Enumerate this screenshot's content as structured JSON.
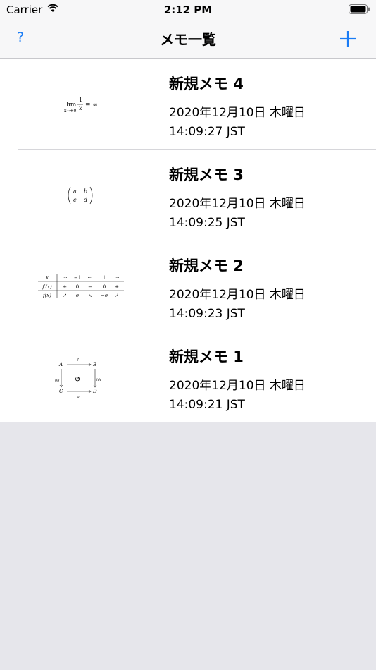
{
  "status_bar": {
    "carrier": "Carrier",
    "time": "2:12 PM",
    "icons": [
      "wifi-icon",
      "battery-icon"
    ]
  },
  "nav": {
    "help_label": "?",
    "title": "メモ一覧",
    "add_icon": "plus-icon",
    "accent_color": "#1a7cf5"
  },
  "memos": [
    {
      "title": "新規メモ 4",
      "date": "2020年12月10日 木曜日",
      "time": "14:09:27 JST",
      "thumbnail": {
        "kind": "limit",
        "lim": "lim",
        "sub": "x→+0",
        "num": "1",
        "den": "x",
        "rhs": "= ∞"
      }
    },
    {
      "title": "新規メモ 3",
      "date": "2020年12月10日 木曜日",
      "time": "14:09:25 JST",
      "thumbnail": {
        "kind": "matrix",
        "a": "a",
        "b": "b",
        "c": "c",
        "d": "d"
      }
    },
    {
      "title": "新規メモ 2",
      "date": "2020年12月10日 木曜日",
      "time": "14:09:23 JST",
      "thumbnail": {
        "kind": "table",
        "rows": [
          [
            "x",
            "···",
            "−1",
            "···",
            "1",
            "···"
          ],
          [
            "f′(x)",
            "+",
            "0",
            "−",
            "0",
            "+"
          ],
          [
            "f(x)",
            "↗",
            "e",
            "↘",
            "−e",
            "↗"
          ]
        ]
      }
    },
    {
      "title": "新規メモ 1",
      "date": "2020年12月10日 木曜日",
      "time": "14:09:21 JST",
      "thumbnail": {
        "kind": "diagram",
        "A": "A",
        "B": "B",
        "C": "C",
        "D": "D",
        "f": "f",
        "k": "k",
        "left": "gg",
        "right": "hh",
        "center": "↺"
      }
    }
  ]
}
